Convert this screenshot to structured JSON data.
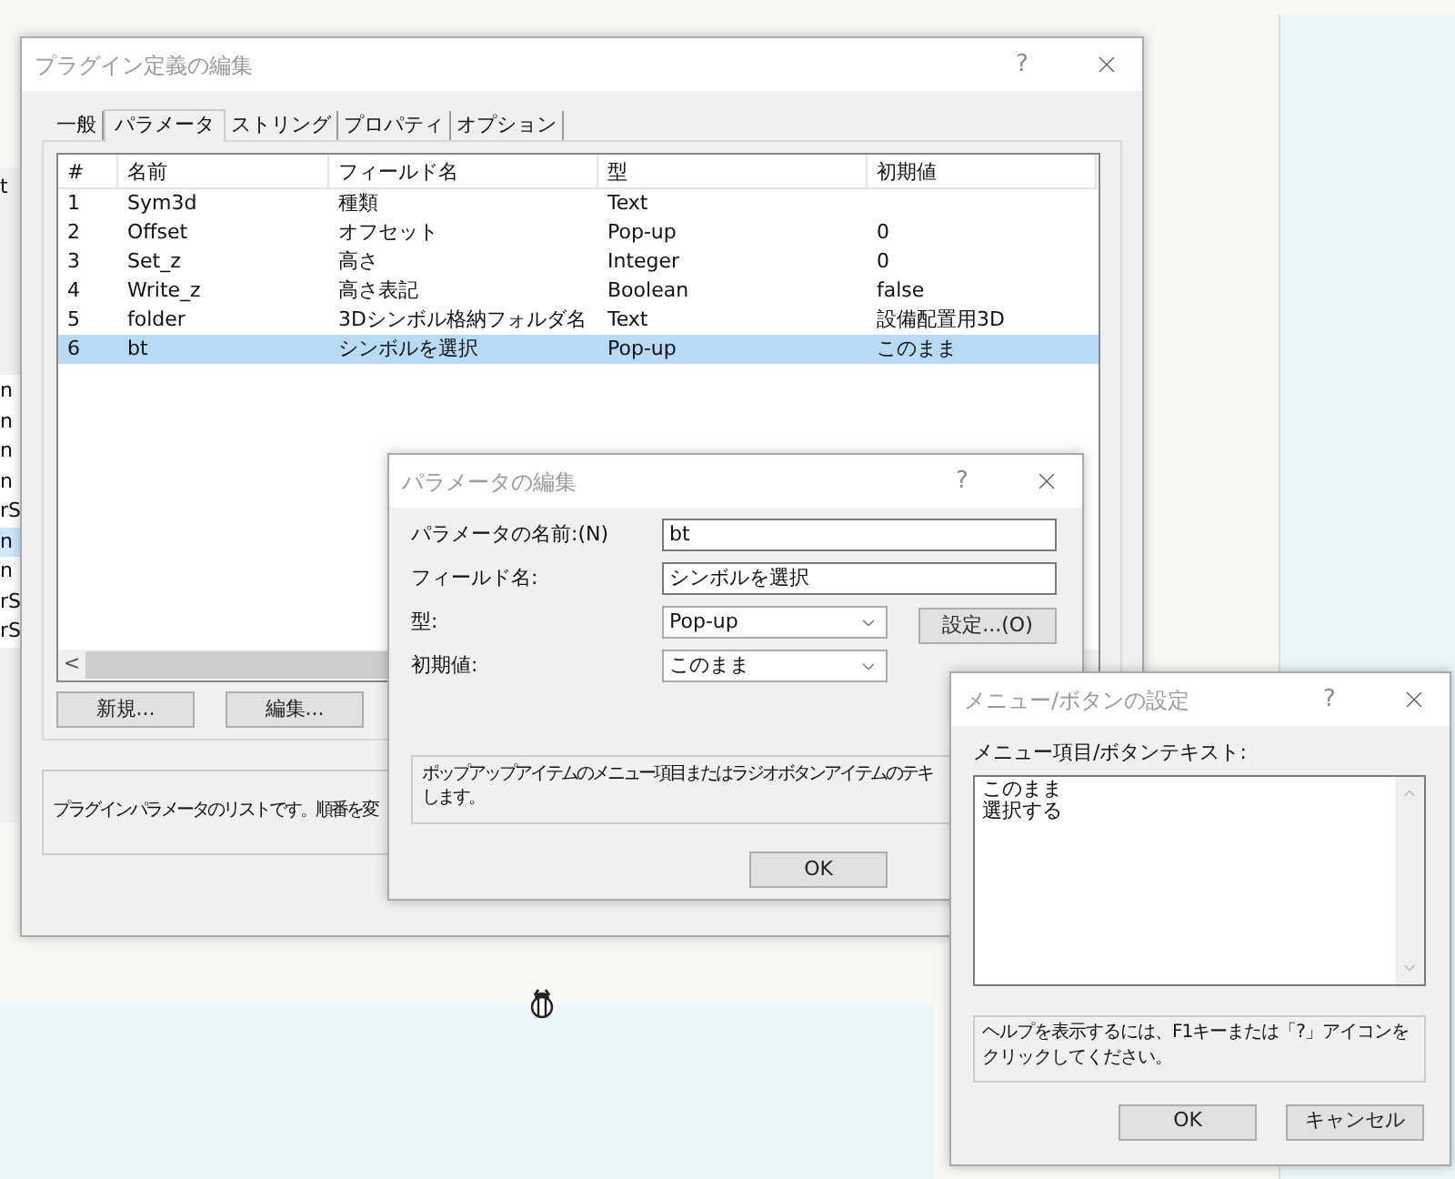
{
  "background_window": {
    "label": "t",
    "items": [
      {
        "text": "n",
        "selected": false
      },
      {
        "text": "n",
        "selected": false
      },
      {
        "text": "n",
        "selected": false
      },
      {
        "text": "n",
        "selected": false
      },
      {
        "text": "rS",
        "selected": false
      },
      {
        "text": "n",
        "selected": true
      },
      {
        "text": "n",
        "selected": false
      },
      {
        "text": "rS",
        "selected": false
      },
      {
        "text": "rS",
        "selected": false
      }
    ]
  },
  "main_dialog": {
    "title": "プラグイン定義の編集",
    "help": "?",
    "tabs": [
      {
        "label": "一般",
        "selected": false
      },
      {
        "label": "パラメータ",
        "selected": true
      },
      {
        "label": "ストリング",
        "selected": false
      },
      {
        "label": "プロパティ",
        "selected": false
      },
      {
        "label": "オプション",
        "selected": false
      }
    ],
    "table": {
      "columns": [
        "#",
        "名前",
        "フィールド名",
        "型",
        "初期値"
      ],
      "rows": [
        {
          "cells": [
            "1",
            "Sym3d",
            "種類",
            "Text",
            ""
          ],
          "selected": false
        },
        {
          "cells": [
            "2",
            "Offset",
            "オフセット",
            "Pop-up",
            "0"
          ],
          "selected": false
        },
        {
          "cells": [
            "3",
            "Set_z",
            "高さ",
            "Integer",
            "0"
          ],
          "selected": false
        },
        {
          "cells": [
            "4",
            "Write_z",
            "高さ表記",
            "Boolean",
            "false"
          ],
          "selected": false
        },
        {
          "cells": [
            "5",
            "folder",
            "3Dシンボル格納フォルダ名",
            "Text",
            "設備配置用3D"
          ],
          "selected": false
        },
        {
          "cells": [
            "6",
            "bt",
            "シンボルを選択",
            "Pop-up",
            "このまま"
          ],
          "selected": true
        }
      ]
    },
    "scroll_left": "<",
    "buttons": [
      "新規...",
      "編集..."
    ],
    "description": "プラグインパラメータのリストです。順番を変"
  },
  "param_dialog": {
    "title": "パラメータの編集",
    "help": "?",
    "fields": [
      {
        "label": "パラメータの名前:(N)",
        "kind": "text",
        "value": "bt"
      },
      {
        "label": "フィールド名:",
        "kind": "text",
        "value": "シンボルを選択"
      },
      {
        "label": "型:",
        "kind": "select",
        "value": "Pop-up",
        "button": "設定...(O)"
      },
      {
        "label": "初期値:",
        "kind": "select",
        "value": "このまま"
      }
    ],
    "description_lines": [
      "ポップアップアイテムのメニュー項目またはラジオボタンアイテムのテキ",
      "します。"
    ],
    "ok": "OK"
  },
  "menu_dialog": {
    "title": "メニュー/ボタンの設定",
    "help": "?",
    "label": "メニュー項目/ボタンテキスト:",
    "lines": [
      "このまま",
      "選択する"
    ],
    "help_text": "ヘルプを表示するには、F1キーまたは「?」アイコンをクリックしてください。",
    "buttons": [
      "OK",
      "キャンセル"
    ]
  }
}
